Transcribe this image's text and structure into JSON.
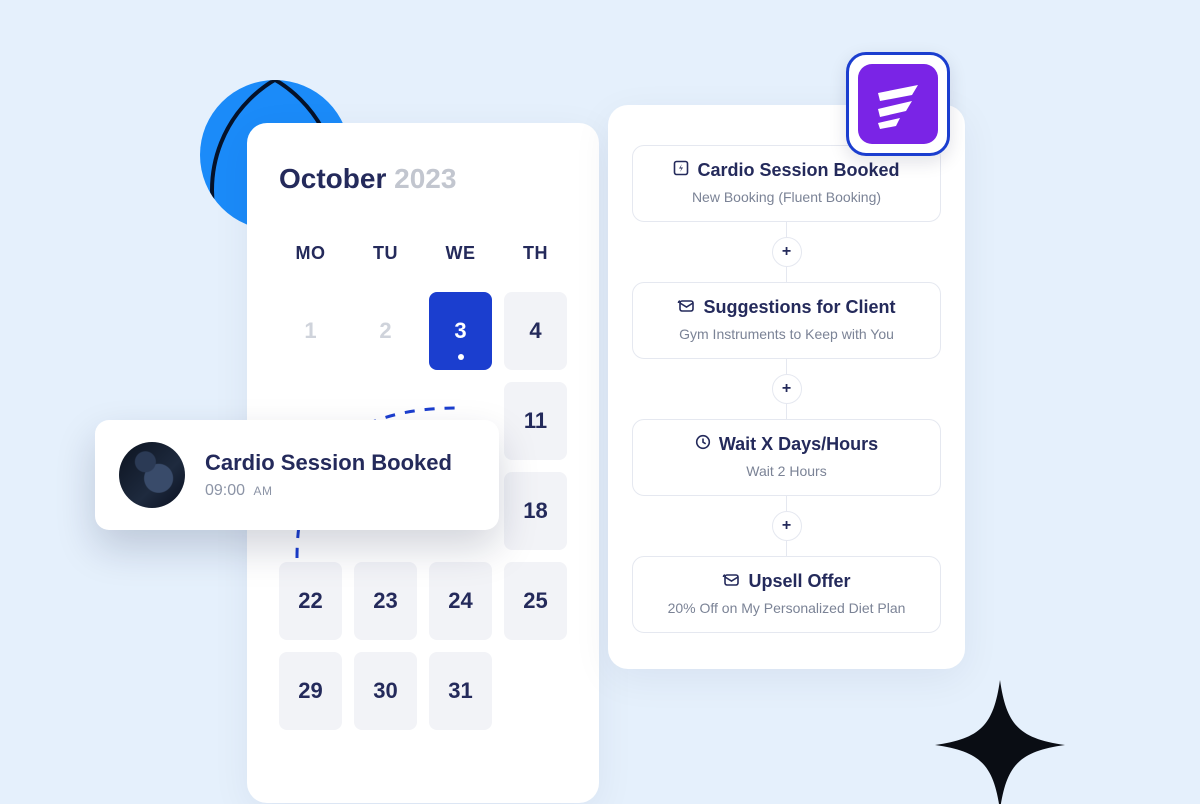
{
  "calendar": {
    "month": "October",
    "year": "2023",
    "dow": [
      "MO",
      "TU",
      "WE",
      "TH"
    ],
    "cells": [
      {
        "label": "1",
        "state": "dim"
      },
      {
        "label": "2",
        "state": "dim"
      },
      {
        "label": "3",
        "state": "sel"
      },
      {
        "label": "4",
        "state": "norm"
      },
      {
        "label": "",
        "state": "blank"
      },
      {
        "label": "",
        "state": "blank"
      },
      {
        "label": "",
        "state": "blank"
      },
      {
        "label": "11",
        "state": "norm"
      },
      {
        "label": "",
        "state": "blank"
      },
      {
        "label": "",
        "state": "blank"
      },
      {
        "label": "",
        "state": "blank"
      },
      {
        "label": "18",
        "state": "norm"
      },
      {
        "label": "22",
        "state": "norm"
      },
      {
        "label": "23",
        "state": "norm"
      },
      {
        "label": "24",
        "state": "norm"
      },
      {
        "label": "25",
        "state": "norm"
      },
      {
        "label": "29",
        "state": "norm"
      },
      {
        "label": "30",
        "state": "norm"
      },
      {
        "label": "31",
        "state": "norm"
      },
      {
        "label": "",
        "state": "blank"
      }
    ]
  },
  "popup": {
    "title": "Cardio Session Booked",
    "time": "09:00",
    "ampm": "AM"
  },
  "automation": {
    "steps": [
      {
        "icon": "bolt",
        "title": "Cardio Session Booked",
        "sub": "New Booking (Fluent Booking)"
      },
      {
        "icon": "mail",
        "title": "Suggestions for Client",
        "sub": "Gym Instruments to Keep with You"
      },
      {
        "icon": "clock",
        "title": "Wait X Days/Hours",
        "sub": "Wait 2 Hours"
      },
      {
        "icon": "mail",
        "title": "Upsell Offer",
        "sub": "20% Off on My Personalized Diet Plan"
      }
    ],
    "plus_label": "+"
  },
  "appbadge": {
    "name": "fluent"
  },
  "colors": {
    "accent": "#1b3ecf",
    "purple": "#7a24e6",
    "blue": "#1b8bf9"
  }
}
